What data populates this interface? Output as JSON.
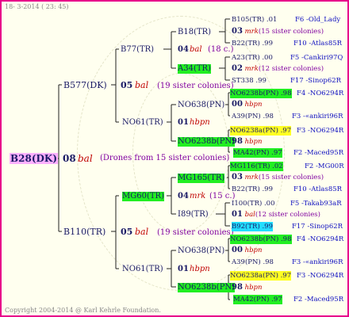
{
  "header": {
    "date": "18-  3-2014 ( 23: 45)"
  },
  "footer": {
    "copyright": "Copyright 2004-2014 @ Karl Kehrle Foundation."
  },
  "root": {
    "name": "B28(DK)",
    "count": "08",
    "tag": "bal",
    "note": "(Drones from 15 sister colonies)"
  },
  "gen1": [
    {
      "name": "B577(DK)",
      "count": "05",
      "tag": "bal",
      "note": "(19 sister colonies)"
    },
    {
      "name": "B110(TR)",
      "count": "05",
      "tag": "bal",
      "note": "(19 sister colonies)"
    }
  ],
  "gen2": [
    {
      "name": "B77(TR)",
      "count": "04",
      "tag": "bal",
      "note": "(18 c.)"
    },
    {
      "name": "NO61(TR)",
      "count": "01",
      "tag": "hbpn",
      "note": ""
    },
    {
      "name": "MG60(TR)",
      "count": "04",
      "tag": "mrk",
      "note": "(15 c.)"
    },
    {
      "name": "NO61(TR)",
      "count": "01",
      "tag": "hbpn",
      "note": ""
    }
  ],
  "gen3": [
    "B18(TR)",
    "A34(TR)",
    "NO638(PN)",
    "NO6238b(PN)",
    "MG165(TR)",
    "I89(TR)",
    "NO638(PN)",
    "NO6238b(PN)"
  ],
  "gen3_counts": [
    {
      "count": "03",
      "tag": "mrk",
      "note": "(15 sister colonies)"
    },
    {
      "count": "02",
      "tag": "mrk",
      "note": "(12 sister colonies)"
    },
    {
      "count": "00",
      "tag": "hbpn",
      "note": ""
    },
    {
      "count": "98",
      "tag": "hbpn",
      "note": ""
    },
    {
      "count": "03",
      "tag": "mrk",
      "note": "(15 sister colonies)"
    },
    {
      "count": "01",
      "tag": "bal",
      "note": "(12 sister colonies)"
    },
    {
      "count": "00",
      "tag": "hbpn",
      "note": ""
    },
    {
      "count": "98",
      "tag": "hbpn",
      "note": ""
    }
  ],
  "gen4": [
    {
      "name": "B105(TR) .01",
      "ref": "F6 -Old_Lady"
    },
    {
      "name": "B22(TR) .99",
      "ref": "F10 -Atlas85R"
    },
    {
      "name": "A23(TR) .00",
      "ref": "F5 -Cankiri97Q"
    },
    {
      "name": "ST338 .99",
      "ref": "F17 -Sinop62R"
    },
    {
      "name": "NO6238b(PN) .98",
      "ref": "F4 -NO6294R"
    },
    {
      "name": "A39(PN) .98",
      "ref": "F3 -«ankiri96R"
    },
    {
      "name": "NO6238a(PN) .97",
      "ref": "F3 -NO6294R"
    },
    {
      "name": "MA42(PN) .97",
      "ref": "F2 -Maced95R"
    },
    {
      "name": "MG116(TR) .02",
      "ref": "F2 -MG00R"
    },
    {
      "name": "B22(TR) .99",
      "ref": "F10 -Atlas85R"
    },
    {
      "name": "I100(TR) .00",
      "ref": "F5 -Takab93aR"
    },
    {
      "name": "B92(TR) .99",
      "ref": "F17 -Sinop62R"
    },
    {
      "name": "NO6238b(PN) .98",
      "ref": "F4 -NO6294R"
    },
    {
      "name": "A39(PN) .98",
      "ref": "F3 -«ankiri96R"
    },
    {
      "name": "NO6238a(PN) .97",
      "ref": "F3 -NO6294R"
    },
    {
      "name": "MA42(PN) .97",
      "ref": "F2 -Maced95R"
    }
  ]
}
